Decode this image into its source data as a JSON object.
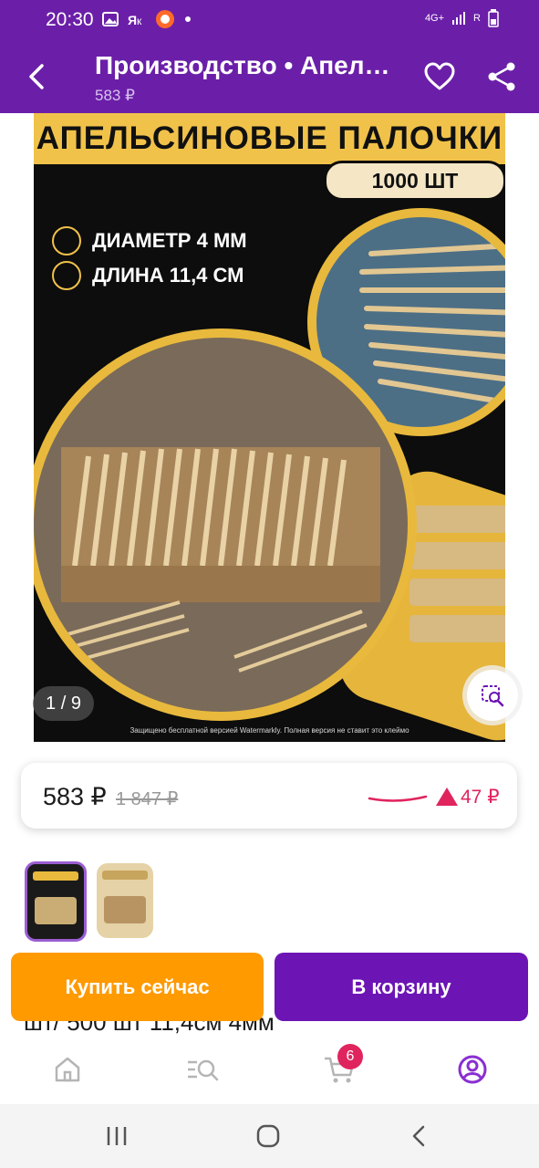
{
  "status_bar": {
    "time": "20:30",
    "left_icons": [
      "image-icon",
      "yandex-icon",
      "app-icon",
      "dot-icon"
    ],
    "right_icons": [
      "network-4g-icon",
      "signal-icon",
      "signal-r-icon",
      "battery-icon"
    ],
    "network_label": "4G+",
    "roaming_label": "R"
  },
  "app_bar": {
    "title": "Производство • Апел…",
    "subtitle": "583 ₽"
  },
  "gallery": {
    "banner_title": "АПЕЛЬСИНОВЫЕ ПАЛОЧКИ",
    "count_label": "1000 ШТ",
    "spec_diameter": "ДИАМЕТР 4 ММ",
    "spec_length": "ДЛИНА 11,4 СМ",
    "footer_note": "Защищено бесплатной версией Watermarkly. Полная версия не ставит это клеймо",
    "page_indicator": "1 / 9"
  },
  "price": {
    "current": "583 ₽",
    "old": "1 847 ₽",
    "diff": "47 ₽",
    "trend_color": "#e0245e"
  },
  "thumbnails": [
    {
      "selected": true
    },
    {
      "selected": false
    }
  ],
  "actions": {
    "buy_now": "Купить сейчас",
    "add_to_cart": "В корзину",
    "buy_color": "#ff9a00",
    "cart_color": "#6d14b5"
  },
  "partial_text": "шт/ 500 шт 11,4см 4мм",
  "bottom_nav": {
    "cart_badge": "6",
    "items": [
      "home-icon",
      "catalog-search-icon",
      "cart-icon",
      "profile-icon"
    ]
  },
  "brand_color": "#6b1fa8"
}
